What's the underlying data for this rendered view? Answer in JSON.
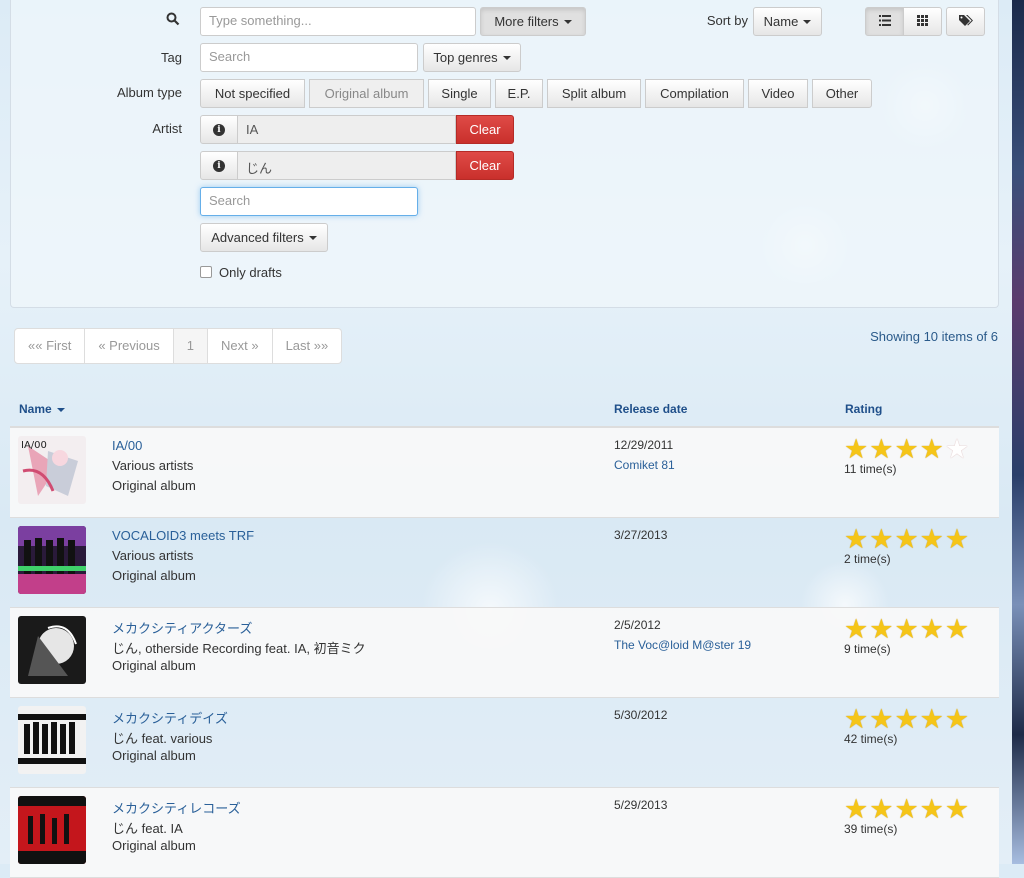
{
  "filters": {
    "search_placeholder": "Type something...",
    "more_filters_label": "More filters",
    "sort_by_label": "Sort by",
    "sort_value": "Name",
    "tag_label": "Tag",
    "tag_placeholder": "Search",
    "top_genres_label": "Top genres",
    "album_type_label": "Album type",
    "album_types": [
      "Not specified",
      "Original album",
      "Single",
      "E.P.",
      "Split album",
      "Compilation",
      "Video",
      "Other"
    ],
    "artist_label": "Artist",
    "artists": [
      {
        "name": "IA",
        "clear": "Clear"
      },
      {
        "name": "じん",
        "clear": "Clear"
      }
    ],
    "artist_search_placeholder": "Search",
    "advanced_filters_label": "Advanced filters",
    "only_drafts_label": "Only drafts"
  },
  "pager": {
    "first": "«« First",
    "previous": "« Previous",
    "current": "1",
    "next": "Next »",
    "last": "Last »»"
  },
  "showing_text": "Showing 10 items of 6",
  "table": {
    "headers": {
      "name": "Name",
      "release_date": "Release date",
      "rating": "Rating"
    },
    "rows": [
      {
        "title": "IA/00",
        "artist": "Various artists",
        "type": "Original album",
        "date": "12/29/2011",
        "event": "Comiket 81",
        "stars": 4,
        "times": "11 time(s)"
      },
      {
        "title": "VOCALOID3 meets TRF",
        "artist": "Various artists",
        "type": "Original album",
        "date": "3/27/2013",
        "event": "",
        "stars": 5,
        "times": "2 time(s)"
      },
      {
        "title": "メカクシティアクターズ",
        "artist": "じん, otherside Recording feat. IA, 初音ミク",
        "type": "Original album",
        "date": "2/5/2012",
        "event": "The Voc@loid M@ster 19",
        "stars": 5,
        "times": "9 time(s)"
      },
      {
        "title": "メカクシティデイズ",
        "artist": "じん feat. various",
        "type": "Original album",
        "date": "5/30/2012",
        "event": "",
        "stars": 5,
        "times": "42 time(s)"
      },
      {
        "title": "メカクシティレコーズ",
        "artist": "じん feat. IA",
        "type": "Original album",
        "date": "5/29/2013",
        "event": "",
        "stars": 5,
        "times": "39 time(s)"
      }
    ]
  },
  "colors": {
    "link": "#2a6099",
    "danger": "#d9534f",
    "star": "#f5c518"
  }
}
